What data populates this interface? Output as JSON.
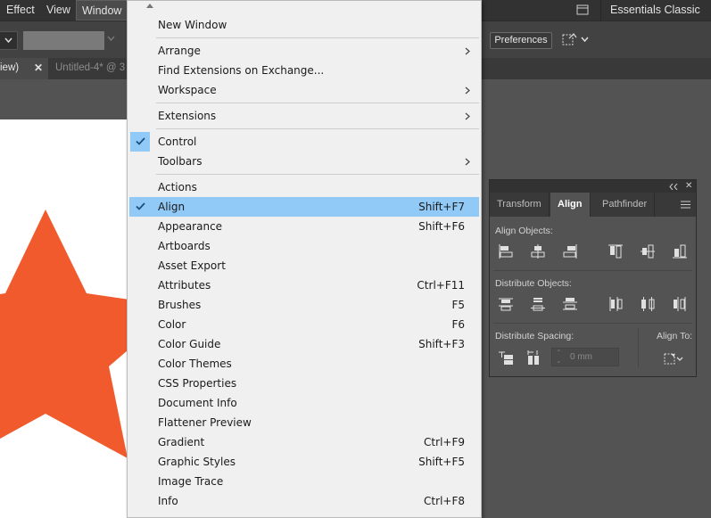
{
  "menubar": {
    "items": [
      {
        "label": "Effect"
      },
      {
        "label": "View"
      },
      {
        "label": "Window"
      }
    ],
    "workspace": "Essentials Classic"
  },
  "controlbar": {
    "preferences_label": "Preferences"
  },
  "tabs": [
    {
      "label": "iew)",
      "active": true
    },
    {
      "label": "Untitled-4* @ 3",
      "active": false
    }
  ],
  "window_menu": {
    "groups": [
      [
        {
          "label": "New Window"
        }
      ],
      [
        {
          "label": "Arrange",
          "submenu": true
        },
        {
          "label": "Find Extensions on Exchange..."
        },
        {
          "label": "Workspace",
          "submenu": true
        }
      ],
      [
        {
          "label": "Extensions",
          "submenu": true
        }
      ],
      [
        {
          "label": "Control",
          "checked": true
        },
        {
          "label": "Toolbars",
          "submenu": true
        }
      ],
      [
        {
          "label": "Actions"
        },
        {
          "label": "Align",
          "shortcut": "Shift+F7",
          "checked": true,
          "highlighted": true
        },
        {
          "label": "Appearance",
          "shortcut": "Shift+F6"
        },
        {
          "label": "Artboards"
        },
        {
          "label": "Asset Export"
        },
        {
          "label": "Attributes",
          "shortcut": "Ctrl+F11"
        },
        {
          "label": "Brushes",
          "shortcut": "F5"
        },
        {
          "label": "Color",
          "shortcut": "F6"
        },
        {
          "label": "Color Guide",
          "shortcut": "Shift+F3"
        },
        {
          "label": "Color Themes"
        },
        {
          "label": "CSS Properties"
        },
        {
          "label": "Document Info"
        },
        {
          "label": "Flattener Preview"
        },
        {
          "label": "Gradient",
          "shortcut": "Ctrl+F9"
        },
        {
          "label": "Graphic Styles",
          "shortcut": "Shift+F5"
        },
        {
          "label": "Image Trace"
        },
        {
          "label": "Info",
          "shortcut": "Ctrl+F8"
        }
      ]
    ]
  },
  "align_panel": {
    "tabs": [
      {
        "label": "Transform"
      },
      {
        "label": "Align",
        "active": true
      },
      {
        "label": "Pathfinder"
      }
    ],
    "align_objects_title": "Align Objects:",
    "distribute_objects_title": "Distribute Objects:",
    "distribute_spacing_title": "Distribute Spacing:",
    "align_to_title": "Align To:",
    "spacing_value": "0 mm"
  },
  "colors": {
    "star": "#f05a2c",
    "highlight": "#91c9f7",
    "menu_bg": "#f0f0f0",
    "app_bg": "#535353"
  },
  "icons": {
    "menu_check": "checkmark-icon",
    "submenu": "chevron-right-icon",
    "scroll": "scroll-up-arrow-icon"
  }
}
